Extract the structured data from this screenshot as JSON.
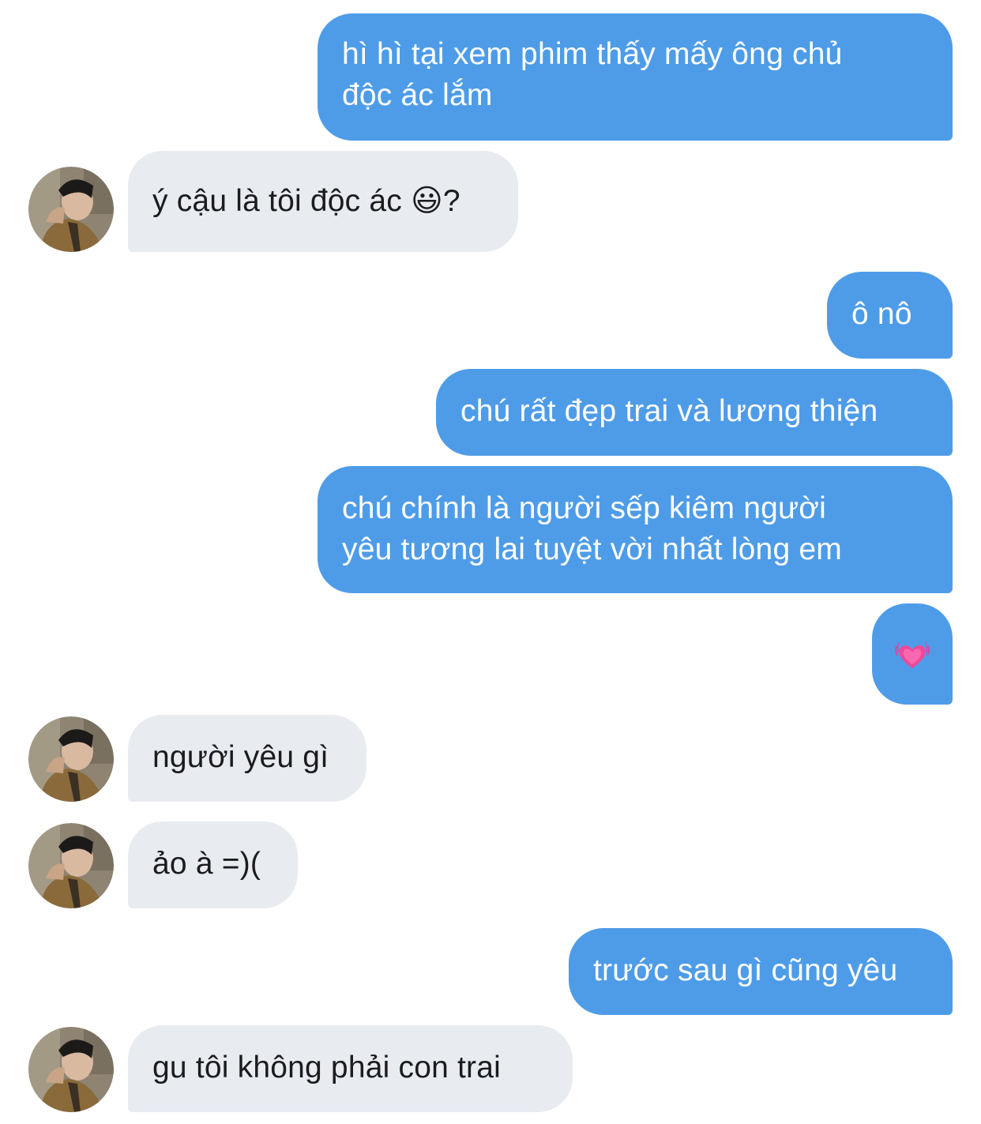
{
  "conversation": {
    "messages": [
      {
        "sender": "me",
        "lines": [
          "hì hì tại xem phim thấy mấy ông chủ",
          "độc ác lắm"
        ]
      },
      {
        "sender": "them",
        "text": "ý cậu là tôi độc ác 😃?"
      },
      {
        "sender": "me",
        "text": "ô nô"
      },
      {
        "sender": "me",
        "text": "chú rất đẹp trai và lương thiện"
      },
      {
        "sender": "me",
        "lines": [
          "chú chính là người sếp kiêm người",
          "yêu tương lai tuyệt vời nhất lòng em"
        ]
      },
      {
        "sender": "me",
        "icon": "growing-heart-emoji"
      },
      {
        "sender": "them",
        "text": "người yêu gì"
      },
      {
        "sender": "them",
        "text": "ảo à =)("
      },
      {
        "sender": "me",
        "text": "trước sau gì cũng yêu"
      },
      {
        "sender": "them",
        "text": "gu tôi không phải con trai"
      }
    ]
  },
  "colors": {
    "sent_bubble": "#4e9ce8",
    "received_bubble": "#e8ebf0",
    "sent_text": "#ffffff",
    "received_text": "#1c1c1e"
  }
}
